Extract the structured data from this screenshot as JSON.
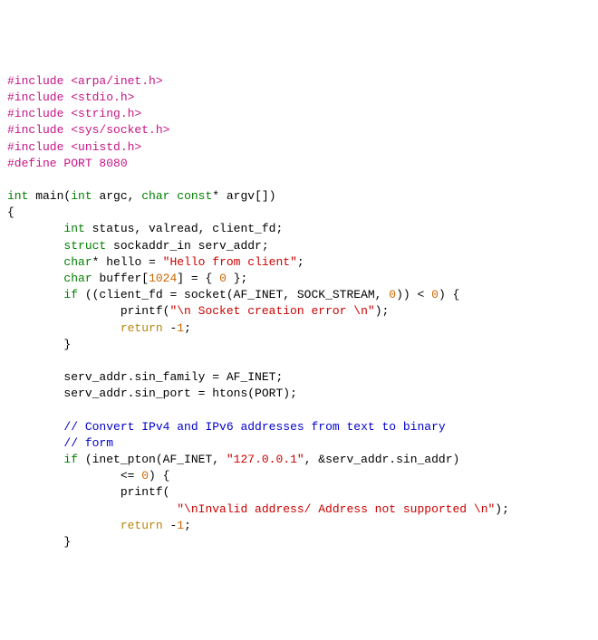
{
  "code": {
    "inc1a": "#include",
    "inc1b": " <arpa/inet.h>",
    "inc2a": "#include",
    "inc2b": " <stdio.h>",
    "inc3a": "#include",
    "inc3b": " <string.h>",
    "inc4a": "#include",
    "inc4b": " <sys/socket.h>",
    "inc5a": "#include",
    "inc5b": " <unistd.h>",
    "def1a": "#define",
    "def1b": " PORT 8080",
    "l_int": "int",
    "l_main": " main",
    "l_sig_open": "(",
    "l_sig_int2": "int",
    "l_sig_argc": " argc, ",
    "l_sig_char": "char",
    "l_sig_const": " const",
    "l_sig_argv": "* argv[])",
    "l_brace_open": "{",
    "decl1_kw": "int",
    "decl1_rest": " status, valread, client_fd;",
    "decl2_kw": "struct",
    "decl2_rest": " sockaddr_in serv_addr;",
    "decl3_kw": "char",
    "decl3_mid": "* hello = ",
    "decl3_str": "\"Hello from client\"",
    "decl3_end": ";",
    "decl4_kw": "char",
    "decl4_mid": " buffer[",
    "decl4_num": "1024",
    "decl4_rest": "] = { ",
    "decl4_zero": "0",
    "decl4_end": " };",
    "if1_kw": "if",
    "if1_a": " ((client_fd = socket(AF_INET, SOCK_STREAM, ",
    "if1_zero": "0",
    "if1_b": ")) < ",
    "if1_zero2": "0",
    "if1_c": ") {",
    "printf1a": "printf(",
    "printf1_str": "\"\\n Socket creation error \\n\"",
    "printf1b": ");",
    "ret1_kw": "return",
    "ret1_sp": " -",
    "ret1_num": "1",
    "ret1_end": ";",
    "brace_close1": "}",
    "assign1": "serv_addr.sin_family = AF_INET;",
    "assign2a": "serv_addr.sin_port = htons(PORT);",
    "comment1": "// Convert IPv4 and IPv6 addresses from text to binary",
    "comment2": "// form",
    "if2_kw": "if",
    "if2_a": " (inet_pton(AF_INET, ",
    "if2_str": "\"127.0.0.1\"",
    "if2_b": ", &serv_addr.sin_addr)",
    "if2_c": "<= ",
    "if2_zero": "0",
    "if2_d": ") {",
    "printf2a": "printf(",
    "printf2_str": "\"\\nInvalid address/ Address not supported \\n\"",
    "printf2b": ");",
    "ret2_kw": "return",
    "ret2_sp": " -",
    "ret2_num": "1",
    "ret2_end": ";",
    "brace_close2": "}"
  }
}
